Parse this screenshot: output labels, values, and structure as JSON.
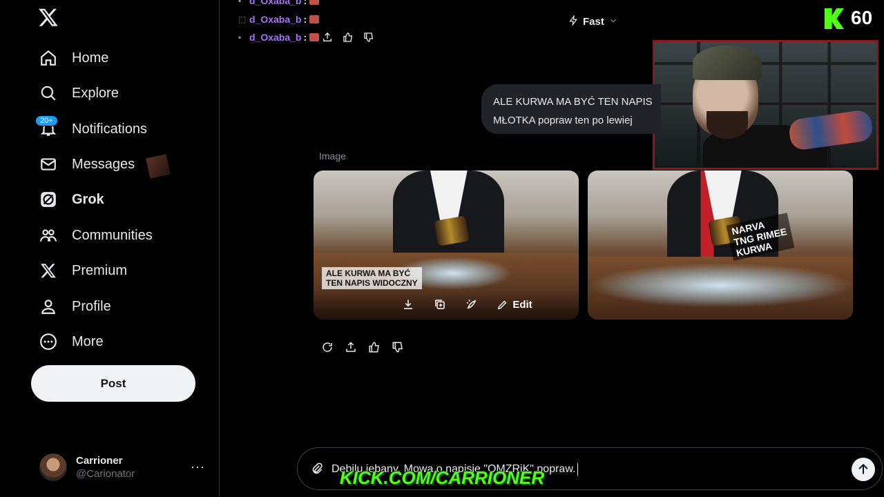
{
  "sidebar": {
    "items": [
      {
        "label": "Home",
        "icon": "home-icon"
      },
      {
        "label": "Explore",
        "icon": "search-icon"
      },
      {
        "label": "Notifications",
        "icon": "bell-icon",
        "badge": "20+"
      },
      {
        "label": "Messages",
        "icon": "mail-icon"
      },
      {
        "label": "Grok",
        "icon": "grok-icon"
      },
      {
        "label": "Communities",
        "icon": "people-icon"
      },
      {
        "label": "Premium",
        "icon": "x-icon"
      },
      {
        "label": "Profile",
        "icon": "person-icon"
      },
      {
        "label": "More",
        "icon": "more-circle-icon"
      }
    ],
    "post_label": "Post",
    "account": {
      "name": "Carrioner",
      "handle": "@Carionator"
    }
  },
  "chat_overlay": {
    "lines": [
      {
        "user": "d_Oxaba_b",
        "sep": ":"
      },
      {
        "user": "d_Oxaba_b",
        "sep": ":"
      },
      {
        "user": "d_Oxaba_b",
        "sep": ":"
      }
    ]
  },
  "mode": {
    "label": "Fast"
  },
  "kick": {
    "viewer_count": "60",
    "url": "KICK.COM/CARRIONER"
  },
  "conversation": {
    "user_message": {
      "line1": "ALE KURWA MA BYĆ TEN NAPIS",
      "line2": "MŁOTKA popraw ten po lewiej"
    },
    "image_label": "Image",
    "images": [
      {
        "overlay_text_1": "ALE KURWA MA BYĆ",
        "overlay_text_2": "TEN NAPIS WIDOCZNY",
        "toolbar": {
          "edit_label": "Edit"
        }
      },
      {
        "overlay_text_1": "NARVA",
        "overlay_text_2": "TNG RIMEE",
        "overlay_text_3": "KURWA"
      }
    ]
  },
  "composer": {
    "value": "Debilu jebany. Mowa o napisie \"OMZRiK\" popraw."
  },
  "colors": {
    "accent": "#1d9bf0",
    "kick_green": "#53fc18",
    "chat_user": "#a874f5",
    "cam_border": "#8a1a1a"
  }
}
